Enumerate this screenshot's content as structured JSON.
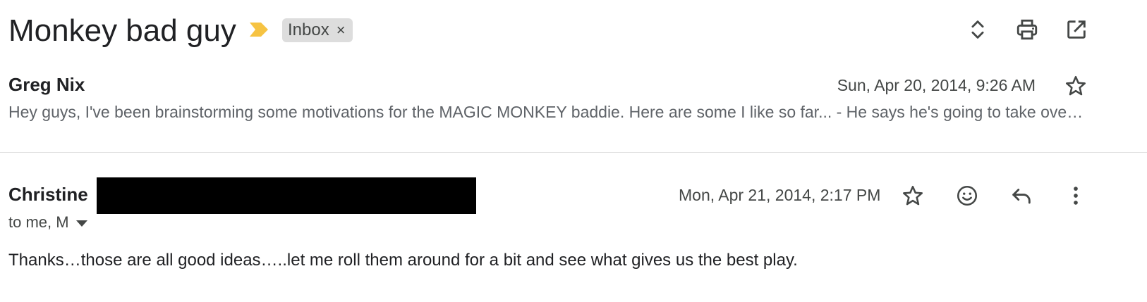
{
  "thread": {
    "subject": "Monkey bad guy",
    "label": "Inbox",
    "label_remove": "×"
  },
  "toolbar": {
    "expand_icon": "expand-collapse-icon",
    "print_icon": "print-icon",
    "popout_icon": "open-in-new-window-icon"
  },
  "messages": [
    {
      "sender": "Greg Nix",
      "date": "Sun, Apr 20, 2014, 9:26 AM",
      "snippet": "Hey guys, I've been brainstorming some motivations for the MAGIC MONKEY baddie. Here are some I like so far... - He says he's going to take over the world with his magic"
    },
    {
      "sender": "Christine",
      "recipients": "to me, M",
      "date": "Mon, Apr 21, 2014, 2:17 PM",
      "body": "Thanks…those are all good ideas…..let me roll them around for a bit and see what gives us the best play."
    }
  ],
  "colors": {
    "importance_marker": "#f6c342",
    "chip_bg": "#dddddd",
    "text_primary": "#202124",
    "text_secondary": "#444746"
  }
}
